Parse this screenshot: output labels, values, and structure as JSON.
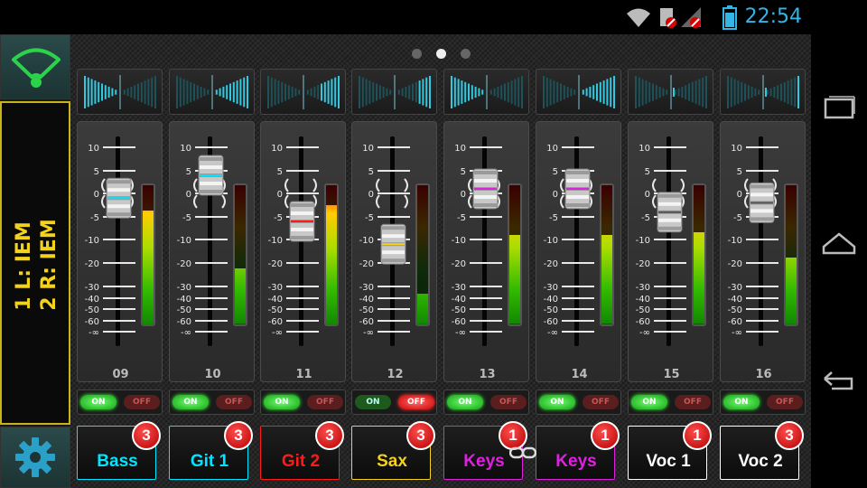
{
  "status_bar": {
    "time": "22:54",
    "icons": [
      "wifi-icon",
      "no-sim-icon",
      "no-signal-icon",
      "battery-icon"
    ],
    "accent": "#33b5e5"
  },
  "left_panel": {
    "wifi_icon": "wifi-icon",
    "mix_line1": "1  L:  IEM",
    "mix_line2": "2  R:  IEM",
    "settings_icon": "gear-icon",
    "accent": "#f2d21b"
  },
  "pager": {
    "pages": 3,
    "active": 1
  },
  "channels": [
    {
      "number": "09",
      "name": "Bass",
      "color": "#00e5ff",
      "badge": "3",
      "on": true,
      "fader_db": -1,
      "meter": 0.82,
      "pan": -1.0
    },
    {
      "number": "10",
      "name": "Git 1",
      "color": "#00e5ff",
      "badge": "3",
      "on": true,
      "fader_db": 4,
      "meter": 0.4,
      "pan": 1.0
    },
    {
      "number": "11",
      "name": "Git 2",
      "color": "#ff1a1a",
      "badge": "3",
      "on": true,
      "fader_db": -6,
      "meter": 0.86,
      "pan": 0.55
    },
    {
      "number": "12",
      "name": "Sax",
      "color": "#f2d21b",
      "badge": "3",
      "on": false,
      "fader_db": -12,
      "meter": 0.22,
      "pan": 0.35
    },
    {
      "number": "13",
      "name": "Keys",
      "color": "#e020e0",
      "badge": "1",
      "on": true,
      "fader_db": 1,
      "meter": 0.64,
      "pan": -1.0
    },
    {
      "number": "14",
      "name": "Keys",
      "color": "#e020e0",
      "badge": "1",
      "on": true,
      "fader_db": 1,
      "meter": 0.64,
      "pan": 1.0
    },
    {
      "number": "15",
      "name": "Voc 1",
      "color": "#ffffff",
      "badge": "1",
      "on": true,
      "fader_db": -4,
      "meter": 0.66,
      "pan": 0.0
    },
    {
      "number": "16",
      "name": "Voc 2",
      "color": "#ffffff",
      "badge": "3",
      "on": true,
      "fader_db": -2,
      "meter": 0.48,
      "pan": 0.05
    }
  ],
  "scale_labels": [
    "10",
    "5",
    "0",
    "-5",
    "-10",
    "-20",
    "-30",
    "-40",
    "-50",
    "-60",
    "-∞"
  ],
  "onoff": {
    "on_label": "ON",
    "off_label": "OFF"
  },
  "link_icon": "link-icon",
  "navbar": {
    "icons": [
      "recent-apps-icon",
      "home-icon",
      "back-icon"
    ]
  }
}
